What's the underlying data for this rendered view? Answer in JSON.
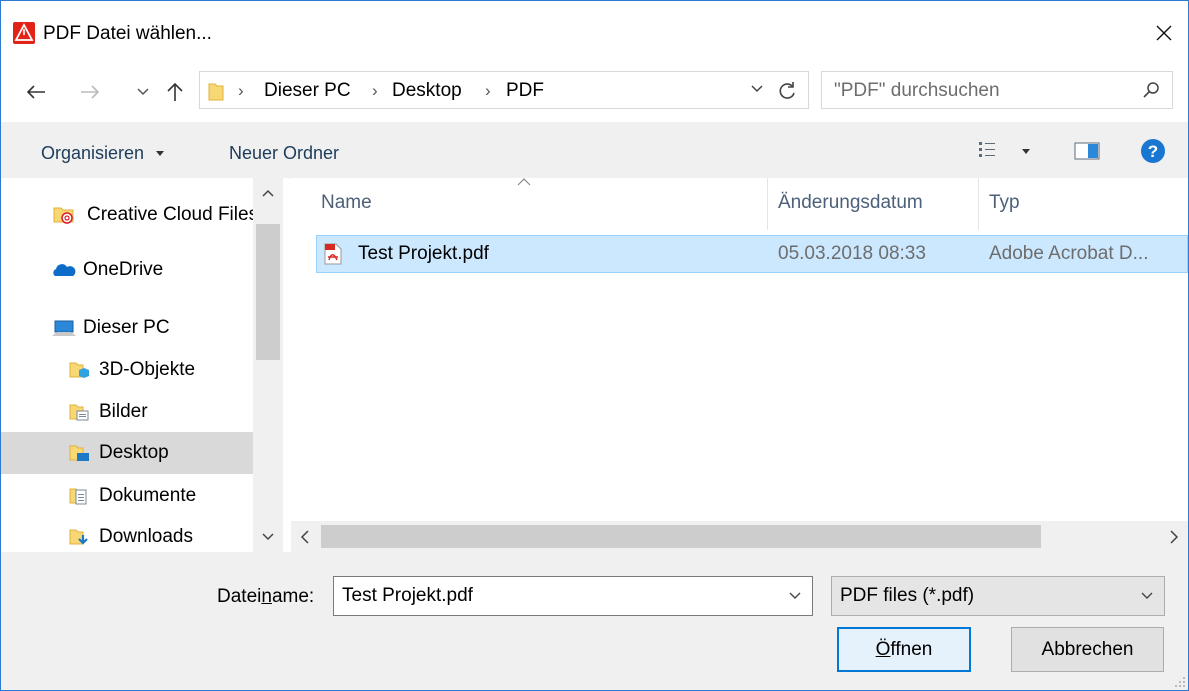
{
  "window": {
    "title": "PDF Datei wählen...",
    "close_glyph": "✕"
  },
  "navigation": {
    "back_icon": "arrow-left-icon",
    "forward_icon": "arrow-right-icon",
    "recent_icon": "chevron-down-icon",
    "up_icon": "arrow-up-icon"
  },
  "address_bar": {
    "crumbs": [
      "Dieser PC",
      "Desktop",
      "PDF"
    ],
    "separator": "›"
  },
  "search": {
    "placeholder": "\"PDF\" durchsuchen"
  },
  "toolbar": {
    "organize_label": "Organisieren",
    "new_folder_label": "Neuer Ordner"
  },
  "nav_pane": {
    "items": [
      {
        "label": "Creative Cloud Files",
        "icon": "creative-cloud-folder-icon"
      },
      {
        "label": "OneDrive",
        "icon": "onedrive-cloud-icon"
      },
      {
        "label": "Dieser PC",
        "icon": "computer-icon"
      },
      {
        "label": "3D-Objekte",
        "icon": "folder-3d-icon"
      },
      {
        "label": "Bilder",
        "icon": "folder-pictures-icon"
      },
      {
        "label": "Desktop",
        "icon": "folder-desktop-icon",
        "selected": true
      },
      {
        "label": "Dokumente",
        "icon": "folder-documents-icon"
      },
      {
        "label": "Downloads",
        "icon": "folder-downloads-icon"
      }
    ]
  },
  "file_list": {
    "columns": [
      "Name",
      "Änderungsdatum",
      "Typ"
    ],
    "rows": [
      {
        "name": "Test Projekt.pdf",
        "date": "05.03.2018 08:33",
        "type": "Adobe Acrobat D...",
        "selected": true
      }
    ]
  },
  "bottom": {
    "filename_label_prefix": "Datei",
    "filename_label_mnemonic": "n",
    "filename_label_suffix": "ame:",
    "filename_value": "Test Projekt.pdf",
    "filetype_value": "PDF files (*.pdf)",
    "open_label_mnemonic": "Ö",
    "open_label_rest": "ffnen",
    "cancel_label": "Abbrechen"
  },
  "colors": {
    "accent": "#0078d7",
    "selection_bg": "#cce8ff",
    "app_icon": "#e2231a"
  }
}
